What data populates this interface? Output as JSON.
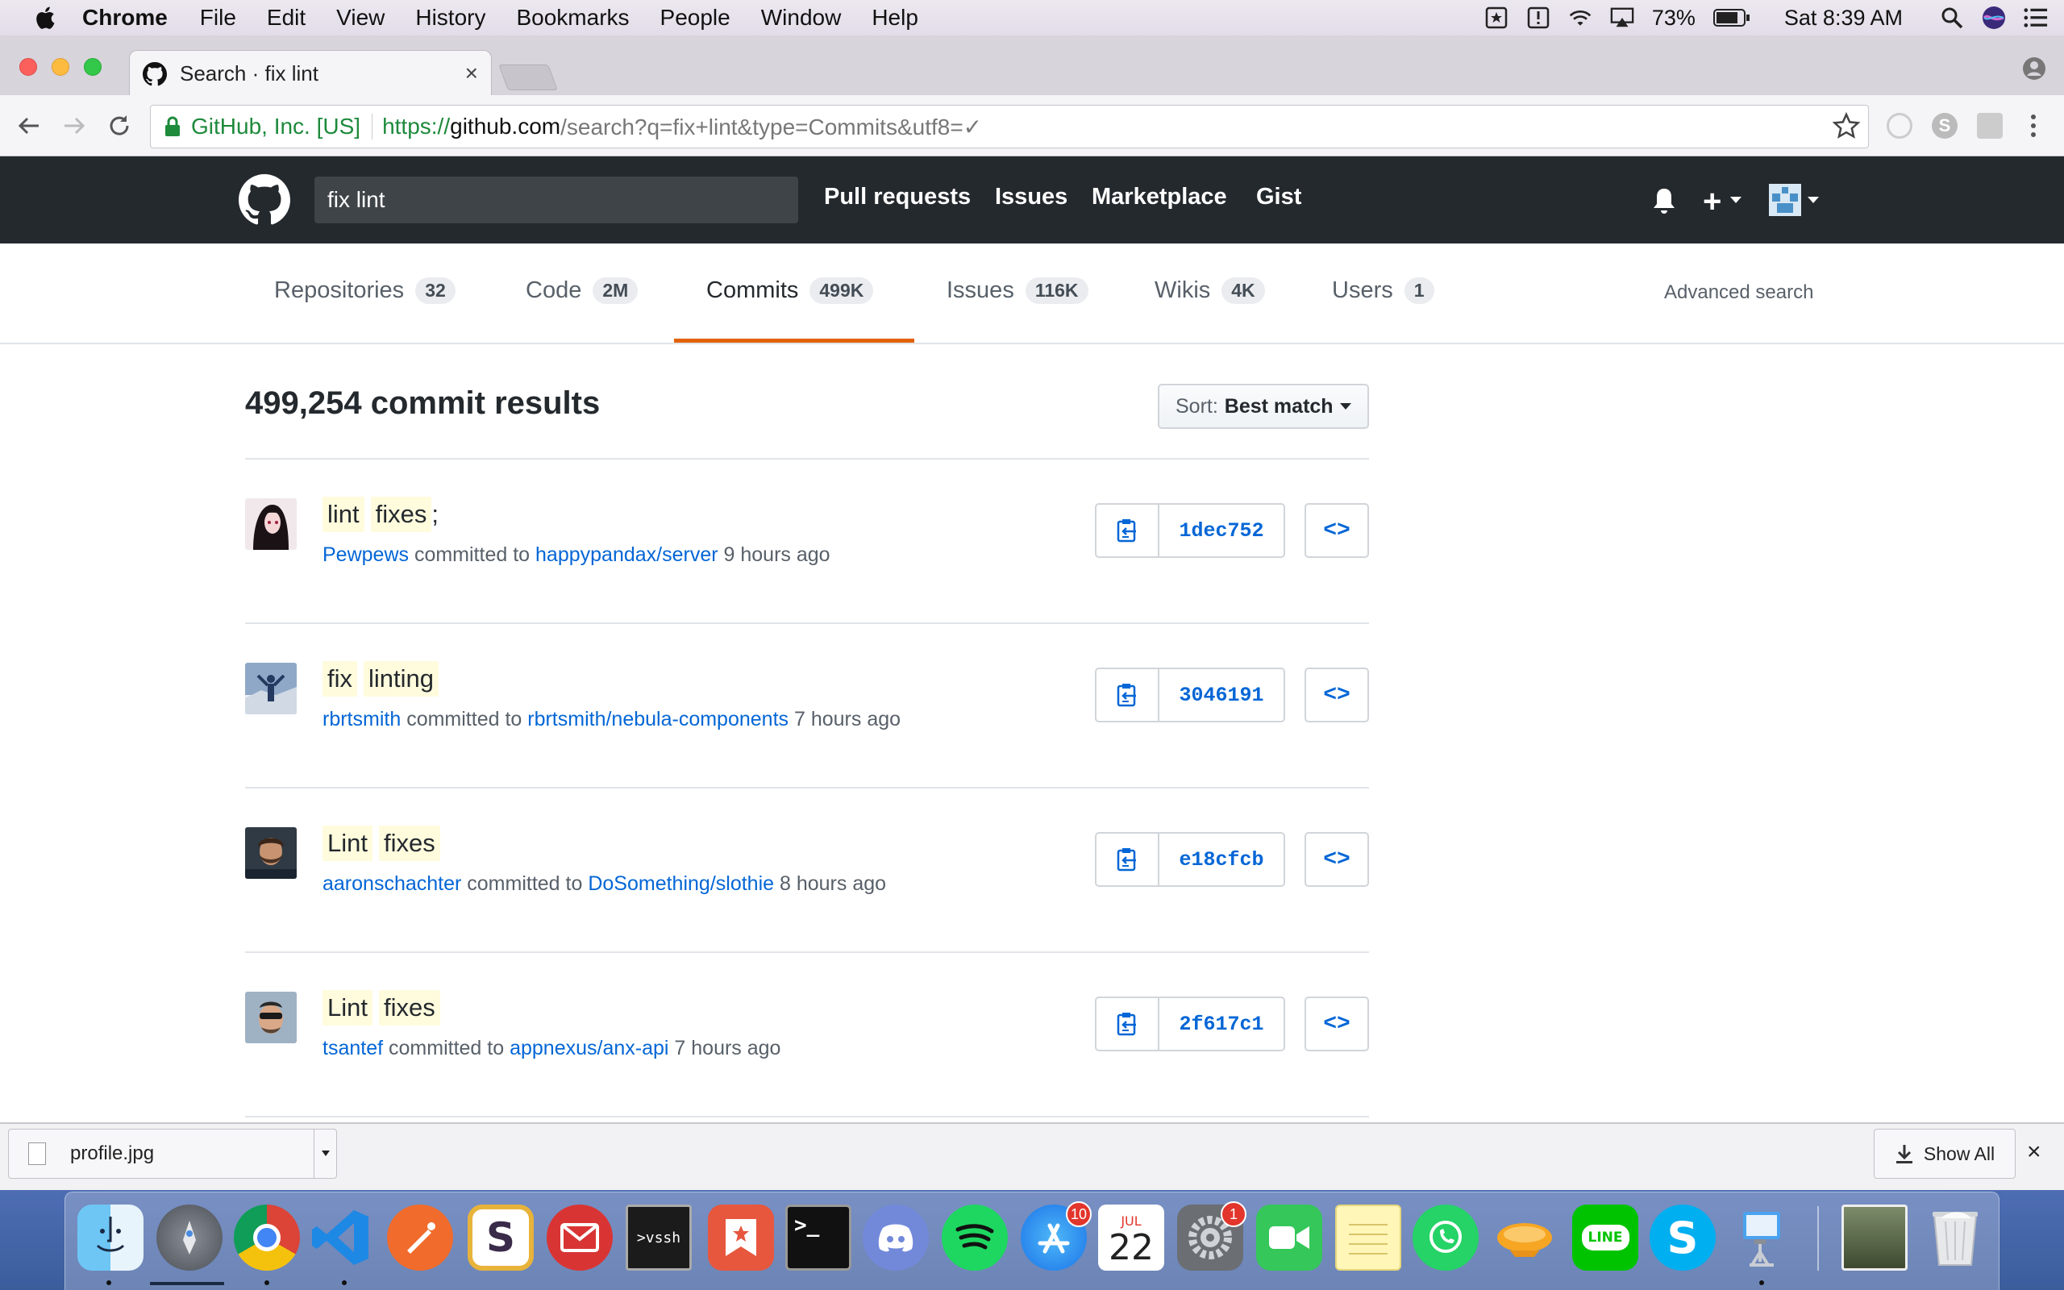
{
  "menubar": {
    "app_name": "Chrome",
    "menus": [
      "File",
      "Edit",
      "View",
      "History",
      "Bookmarks",
      "People",
      "Window",
      "Help"
    ],
    "battery": "73%",
    "clock": "Sat 8:39 AM"
  },
  "browser": {
    "tab_title": "Search · fix lint",
    "tab_close": "×",
    "ev_label": "GitHub, Inc. [US]",
    "url_protocol": "https://",
    "url_host": "github.com",
    "url_path": "/search?q=fix+lint&type=Commits&utf8=✓"
  },
  "github": {
    "search_value": "fix lint",
    "nav": [
      "Pull requests",
      "Issues",
      "Marketplace",
      "Gist"
    ],
    "plus": "+"
  },
  "search_tabs": [
    {
      "label": "Repositories",
      "count": "32"
    },
    {
      "label": "Code",
      "count": "2M"
    },
    {
      "label": "Commits",
      "count": "499K"
    },
    {
      "label": "Issues",
      "count": "116K"
    },
    {
      "label": "Wikis",
      "count": "4K"
    },
    {
      "label": "Users",
      "count": "1"
    }
  ],
  "selected_tab": "Commits",
  "advanced_search": "Advanced search",
  "results": {
    "title": "499,254 commit results",
    "sort_label": "Sort:",
    "sort_value": "Best match"
  },
  "commits": [
    {
      "words": [
        "lint",
        "fixes"
      ],
      "suffix": ";",
      "author": "Pewpews",
      "committed_to": "committed to",
      "repo": "happypandax/server",
      "time": "9 hours ago",
      "sha": "1dec752"
    },
    {
      "words": [
        "fix",
        "linting"
      ],
      "suffix": "",
      "author": "rbrtsmith",
      "committed_to": "committed to",
      "repo": "rbrtsmith/nebula-components",
      "time": "7 hours ago",
      "sha": "3046191"
    },
    {
      "words": [
        "Lint",
        "fixes"
      ],
      "suffix": "",
      "author": "aaronschachter",
      "committed_to": "committed to",
      "repo": "DoSomething/slothie",
      "time": "8 hours ago",
      "sha": "e18cfcb"
    },
    {
      "words": [
        "Lint",
        "fixes"
      ],
      "suffix": "",
      "author": "tsantef",
      "committed_to": "committed to",
      "repo": "appnexus/anx-api",
      "time": "7 hours ago",
      "sha": "2f617c1"
    }
  ],
  "browse_label": "<>",
  "downloads": {
    "file": "profile.jpg",
    "show_all": "Show All",
    "close": "×"
  },
  "dock": {
    "badges": {
      "app_store": "10",
      "system_prefs": "1"
    },
    "calendar_month": "JUL",
    "calendar_day": "22",
    "vssh_label": ">vssh",
    "terminal_label": ">_",
    "line_label": "LINE"
  }
}
